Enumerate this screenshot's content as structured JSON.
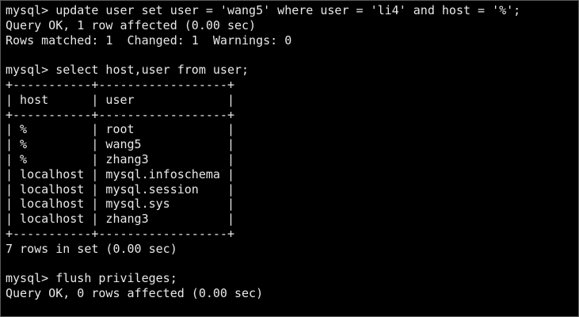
{
  "terminal": {
    "lines": [
      "mysql> update user set user = 'wang5' where user = 'li4' and host = '%';",
      "Query OK, 1 row affected (0.00 sec)",
      "Rows matched: 1  Changed: 1  Warnings: 0",
      "",
      "mysql> select host,user from user;",
      "+-----------+------------------+",
      "| host      | user             |",
      "+-----------+------------------+",
      "| %         | root             |",
      "| %         | wang5            |",
      "| %         | zhang3           |",
      "| localhost | mysql.infoschema |",
      "| localhost | mysql.session    |",
      "| localhost | mysql.sys        |",
      "| localhost | zhang3           |",
      "+-----------+------------------+",
      "7 rows in set (0.00 sec)",
      "",
      "mysql> flush privileges;",
      "Query OK, 0 rows affected (0.00 sec)"
    ]
  }
}
